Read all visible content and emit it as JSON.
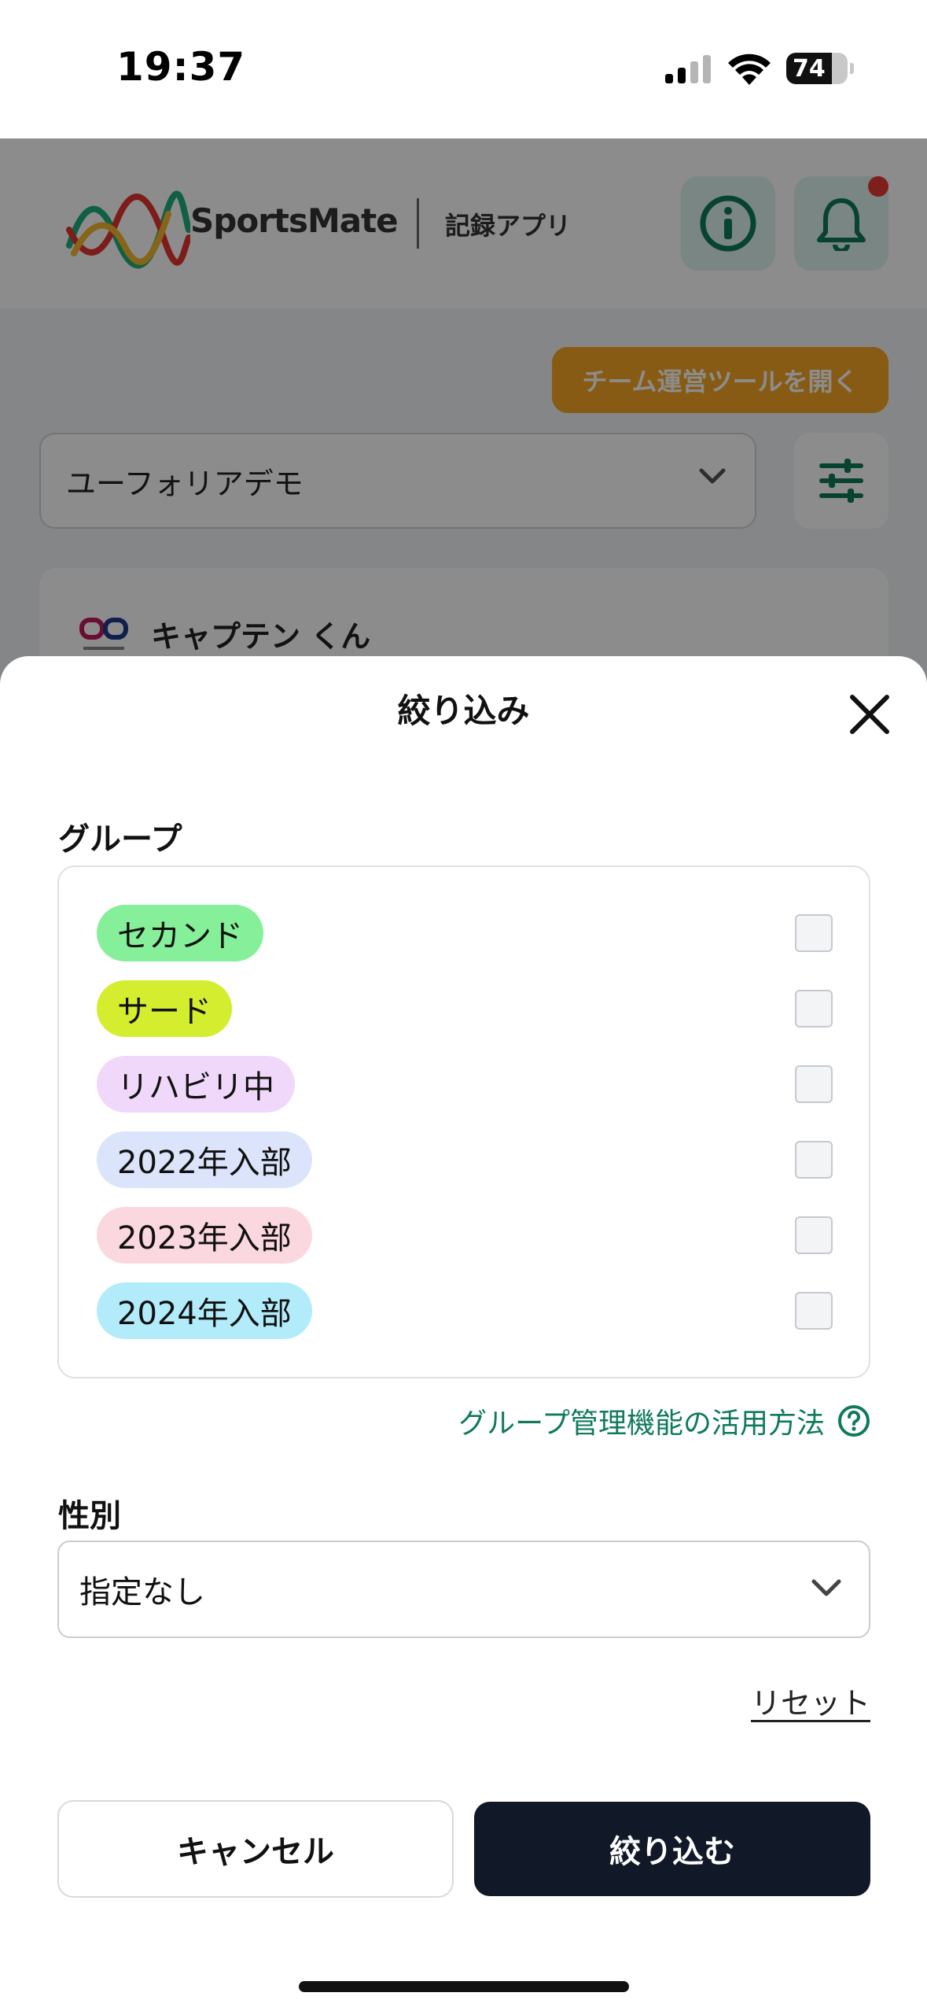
{
  "status_bar": {
    "time": "19:37",
    "battery_level": "74"
  },
  "app": {
    "logo_text": "SportsMate",
    "logo_subtitle": "記録アプリ",
    "team_tool_button": "チーム運営ツールを開く",
    "team_select_value": "ユーフォリアデモ",
    "member_name": "キャプテン くん",
    "colors": {
      "accent": "#0f7a5c",
      "tool_button": "#f6a623",
      "notification_dot": "#e53935"
    }
  },
  "sheet": {
    "title": "絞り込み",
    "group_label": "グループ",
    "groups": [
      {
        "label": "セカンド",
        "color": "#86ef9a",
        "checked": false
      },
      {
        "label": "サード",
        "color": "#d4ed2f",
        "checked": false
      },
      {
        "label": "リハビリ中",
        "color": "#f0d8fb",
        "checked": false
      },
      {
        "label": "2022年入部",
        "color": "#dbe4fb",
        "checked": false
      },
      {
        "label": "2023年入部",
        "color": "#fbd7e0",
        "checked": false
      },
      {
        "label": "2024年入部",
        "color": "#b2ecfa",
        "checked": false
      }
    ],
    "help_link": "グループ管理機能の活用方法",
    "gender_label": "性別",
    "gender_value": "指定なし",
    "reset_label": "リセット",
    "cancel_label": "キャンセル",
    "apply_label": "絞り込む",
    "colors": {
      "apply_button": "#111827",
      "link": "#0f7a5c"
    }
  },
  "icons": {
    "close": "close-icon",
    "help": "question-circle-icon",
    "dropdown": "chevron-down-icon",
    "info": "info-icon",
    "bell": "bell-icon",
    "filter": "sliders-icon"
  }
}
